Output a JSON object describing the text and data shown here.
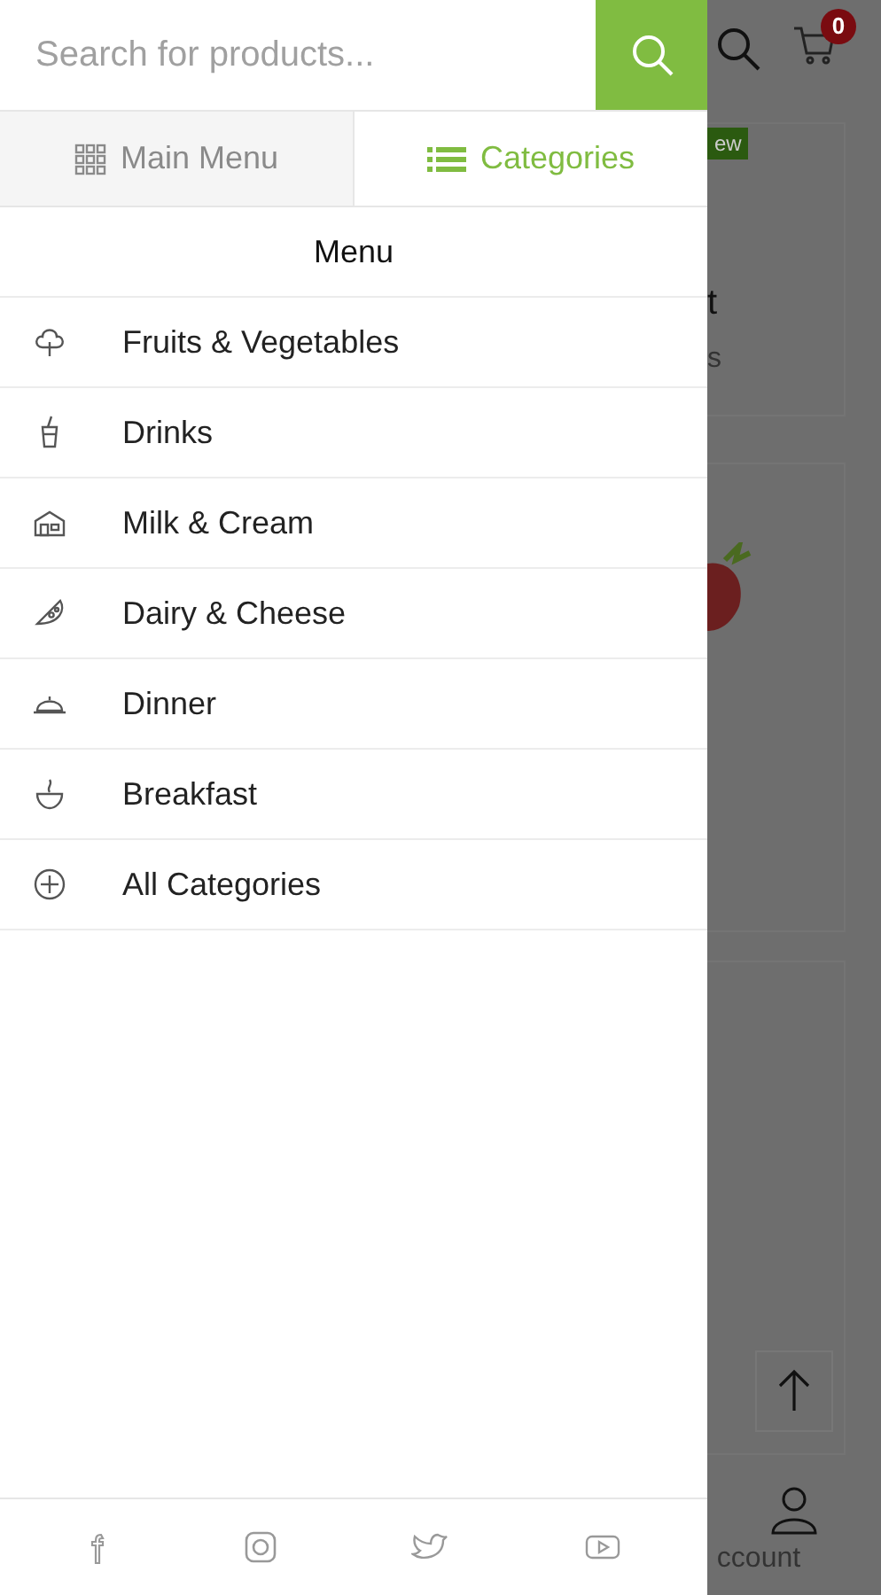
{
  "search": {
    "placeholder": "Search for products..."
  },
  "tabs": [
    {
      "label": "Main Menu",
      "selected": false
    },
    {
      "label": "Categories",
      "selected": true
    }
  ],
  "menu_title": "Menu",
  "categories": [
    {
      "label": "Fruits & Vegetables"
    },
    {
      "label": "Drinks"
    },
    {
      "label": "Milk & Cream"
    },
    {
      "label": "Dairy & Cheese"
    },
    {
      "label": "Dinner"
    },
    {
      "label": "Breakfast"
    },
    {
      "label": "All Categories"
    }
  ],
  "background": {
    "cart_count": "0",
    "badge": "ew",
    "fragments": [
      "t",
      "s"
    ],
    "account_label": "ccount"
  }
}
